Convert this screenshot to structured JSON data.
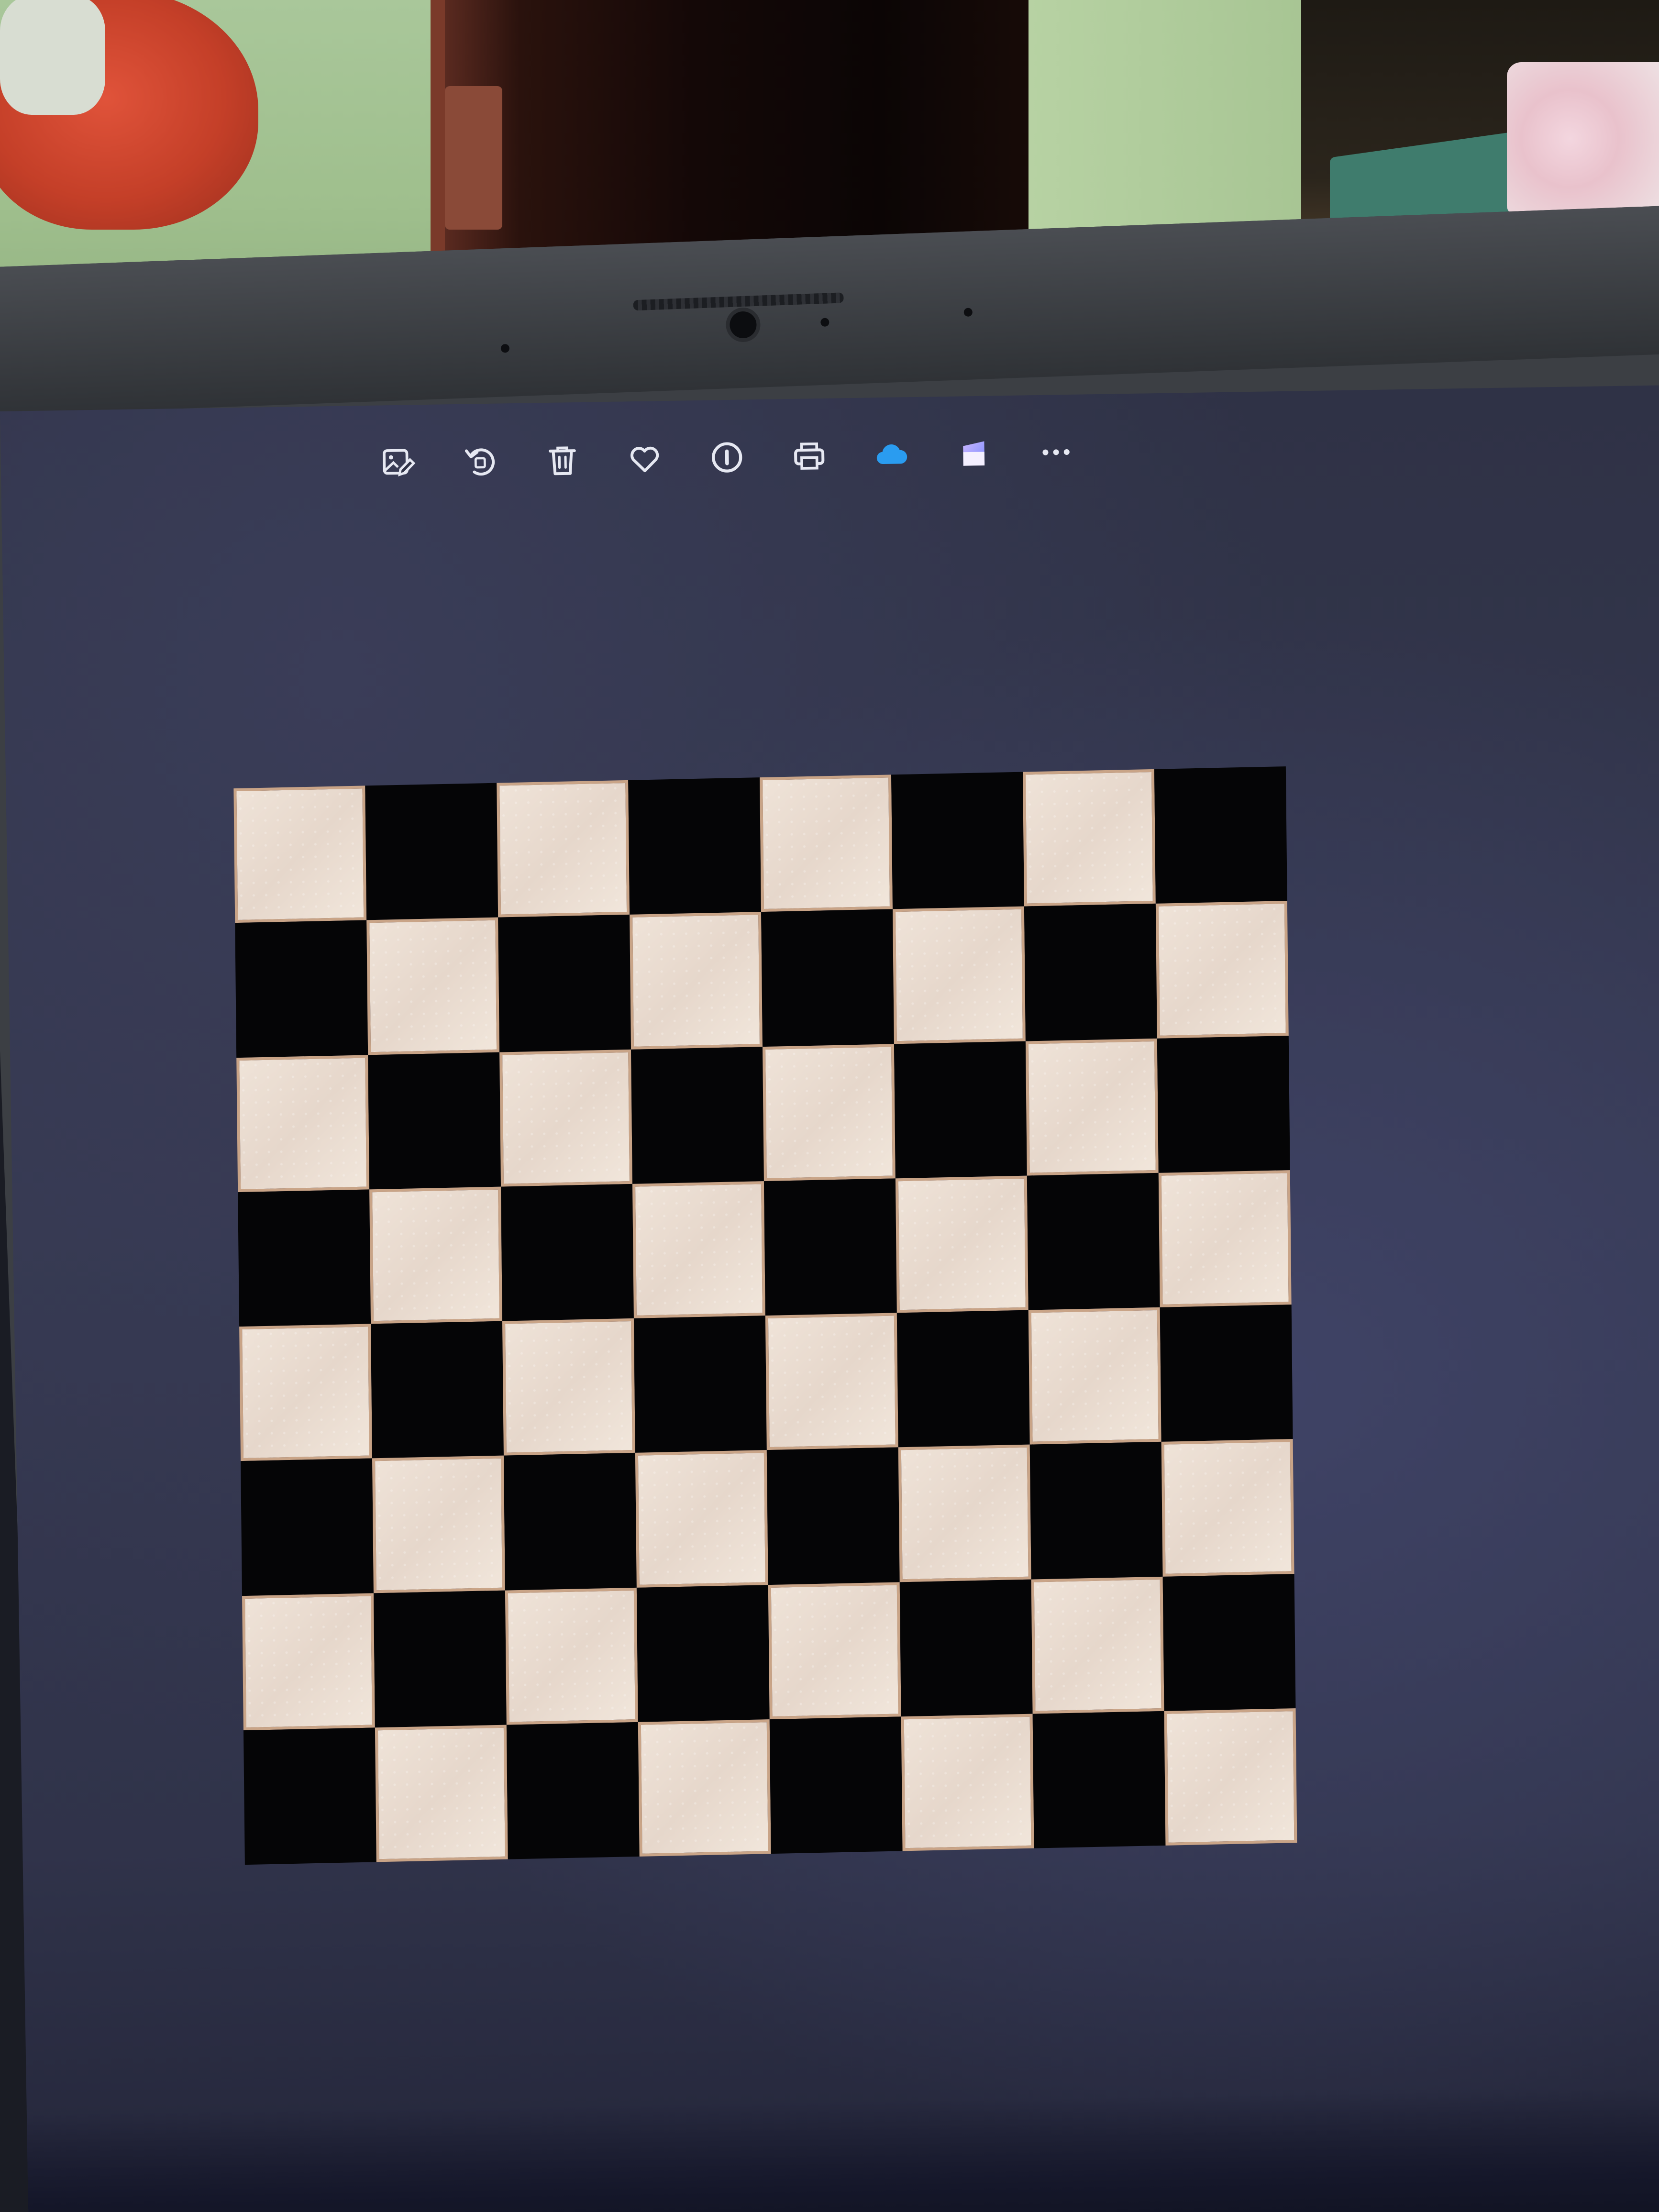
{
  "toolbar": {
    "buttons": [
      {
        "id": "edit",
        "icon": "edit-image-icon"
      },
      {
        "id": "rotate",
        "icon": "rotate-icon"
      },
      {
        "id": "delete",
        "icon": "trash-icon"
      },
      {
        "id": "favorite",
        "icon": "heart-icon"
      },
      {
        "id": "info",
        "icon": "info-icon"
      },
      {
        "id": "print",
        "icon": "printer-icon"
      },
      {
        "id": "onedrive",
        "icon": "cloud-icon"
      },
      {
        "id": "clipchamp",
        "icon": "video-editor-icon"
      },
      {
        "id": "more",
        "icon": "more-options-icon"
      }
    ],
    "icon_color": "#e6e8f2",
    "cloud_color": "#2a9cf0"
  },
  "image": {
    "content": "checkerboard",
    "rows": 8,
    "columns": 8,
    "light_color": "#ece0d5",
    "dark_color": "#050506"
  },
  "colors": {
    "screen_bg": "#32354c",
    "bezel": "#3c3f44"
  }
}
